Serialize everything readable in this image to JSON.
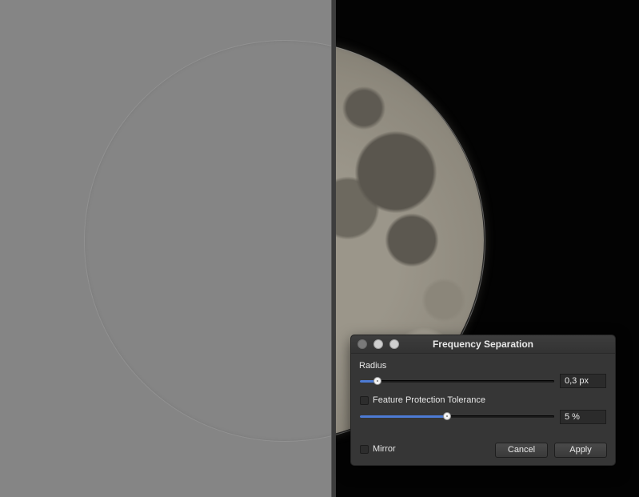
{
  "canvas": {
    "image_subject": "moon"
  },
  "dialog": {
    "title": "Frequency Separation",
    "radius": {
      "label": "Radius",
      "value_text": "0,3 px",
      "fraction": 0.09
    },
    "feature_protection": {
      "label": "Feature Protection Tolerance",
      "checked": false
    },
    "tolerance": {
      "value_text": "5 %",
      "fraction": 0.45
    },
    "mirror": {
      "label": "Mirror",
      "checked": false
    },
    "buttons": {
      "cancel": "Cancel",
      "apply": "Apply"
    }
  },
  "colors": {
    "accent": "#4d7bd4",
    "dialog_bg": "#363636",
    "filtered_bg": "#858585"
  }
}
